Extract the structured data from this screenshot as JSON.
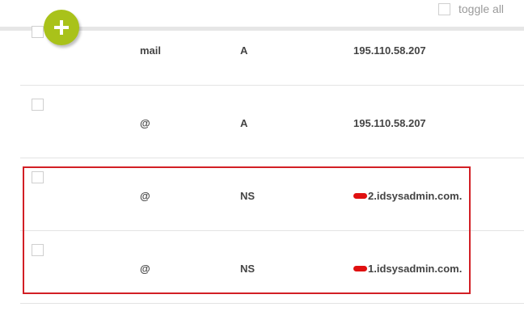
{
  "toolbar": {
    "toggle_all_label": "toggle all",
    "add_icon": "plus-icon",
    "add_button_color": "#a9c21a"
  },
  "records": [
    {
      "name": "mail",
      "type": "A",
      "value": "195.110.58.207",
      "redacted": false
    },
    {
      "name": "@",
      "type": "A",
      "value": "195.110.58.207",
      "redacted": false
    },
    {
      "name": "@",
      "type": "NS",
      "value": "2.idsysadmin.com.",
      "redacted": true
    },
    {
      "name": "@",
      "type": "NS",
      "value": "1.idsysadmin.com.",
      "redacted": true
    }
  ],
  "highlight_color": "#d21f25"
}
